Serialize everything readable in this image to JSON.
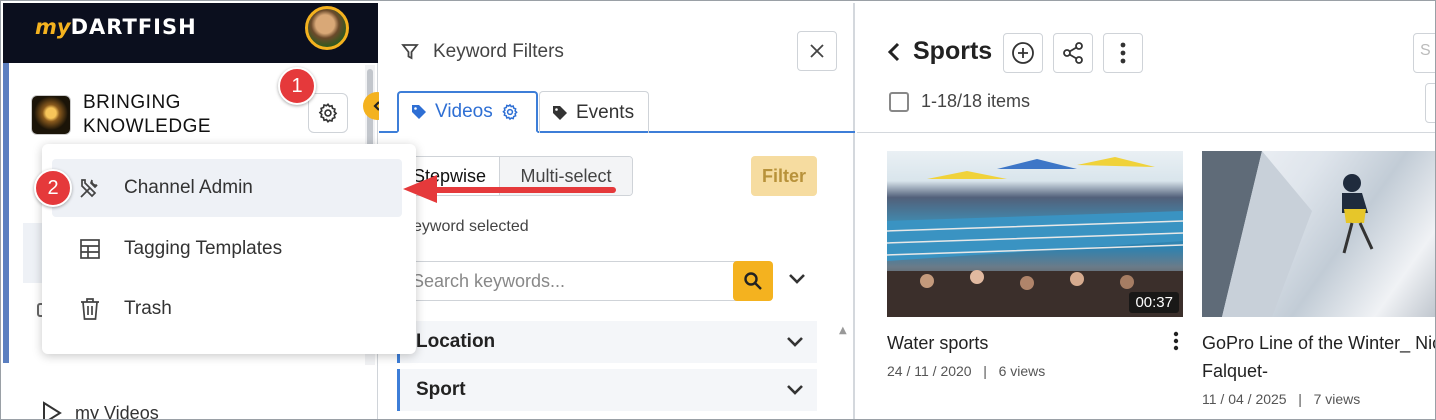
{
  "app": {
    "logo_prefix": "my",
    "logo_main": "DARTFISH"
  },
  "sidebar": {
    "channel_name_line1": "BRINGING",
    "channel_name_line2": "KNOWLEDGE",
    "bottom_item": "my Videos"
  },
  "dropdown": {
    "items": [
      {
        "label": "Channel Admin",
        "icon": "tools-icon"
      },
      {
        "label": "Tagging Templates",
        "icon": "table-icon"
      },
      {
        "label": "Trash",
        "icon": "trash-icon"
      }
    ]
  },
  "badges": {
    "one": "1",
    "two": "2"
  },
  "filters": {
    "title": "Keyword Filters",
    "tabs": [
      {
        "label": "Videos"
      },
      {
        "label": "Events"
      }
    ],
    "mode_stepwise": "Stepwise",
    "mode_multi": "Multi-select",
    "filter_button": "Filter",
    "selected_text": "keyword selected",
    "search_placeholder": "Search keywords...",
    "facets": [
      {
        "label": "Location"
      },
      {
        "label": "Sport"
      }
    ]
  },
  "content": {
    "title": "Sports",
    "items_count": "1-18/18 items",
    "cards": [
      {
        "title": "Water sports",
        "date": "24 / 11 / 2020",
        "views": "6 views",
        "duration": "00:37"
      },
      {
        "title": "GoPro Line of the Winter_ Nicolas Falquet-",
        "date": "11 / 04 / 2025",
        "views": "7 views"
      }
    ]
  },
  "colors": {
    "accent_yellow": "#f4b21f",
    "accent_blue": "#3d7ed8",
    "badge_red": "#e5393b",
    "topbar": "#0b0f1e"
  }
}
